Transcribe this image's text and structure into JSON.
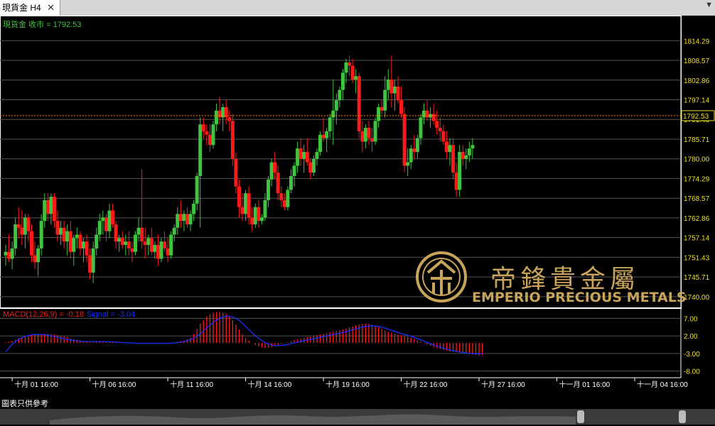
{
  "window": {
    "tab_title": "現貨金 H4",
    "close_glyph": "✕",
    "menu_glyph": "▼"
  },
  "disclaimer": "圖表只供參考",
  "logo": {
    "chinese": "帝鋒貴金屬",
    "english": "EMPERIO PRECIOUS METALS",
    "color": "#c8a45a"
  },
  "colors": {
    "bull": "#3fc43f",
    "bear": "#ff1a1a",
    "price_label": "#f0e020",
    "current_line": "#ff8c00",
    "macd_hist": "#ff1a1a",
    "macd_signal": "#1830ff"
  },
  "chart_data": [
    {
      "type": "candlestick",
      "title": "現貨金 收市 = 1792.53",
      "symbol": "現貨金",
      "timeframe": "H4",
      "current_price": 1792.53,
      "current_price_label": "1792.53",
      "ylim": [
        1737.5,
        1819.5
      ],
      "y_ticks": [
        1814.29,
        1808.57,
        1802.86,
        1797.14,
        1791.43,
        1785.71,
        1780.0,
        1774.29,
        1768.57,
        1762.86,
        1757.14,
        1751.43,
        1745.71,
        1740.0
      ],
      "y_tick_labels": [
        "1814.29",
        "1808.57",
        "1802.86",
        "1797.14",
        "1791.43",
        "1785.71",
        "1780.00",
        "1774.29",
        "1768.57",
        "1762.86",
        "1757.14",
        "1751.43",
        "1745.71",
        "1740.00"
      ],
      "x_tick_labels": [
        "十月 01 16:00",
        "十月 06 16:00",
        "十月 11 16:00",
        "十月 14 16:00",
        "十月 19 16:00",
        "十月 22 16:00",
        "十月 27 16:00",
        "十一月 01 16:00",
        "十一月 04 16:00"
      ],
      "x_tick_index": [
        2,
        26,
        50,
        74,
        98,
        122,
        146,
        170,
        194
      ],
      "grid": true,
      "ohlc": [
        [
          1752,
          1755,
          1749,
          1753
        ],
        [
          1753,
          1758,
          1750,
          1751
        ],
        [
          1751,
          1756,
          1748,
          1754
        ],
        [
          1754,
          1763,
          1752,
          1761
        ],
        [
          1761,
          1766,
          1757,
          1760
        ],
        [
          1760,
          1765,
          1755,
          1758
        ],
        [
          1758,
          1764,
          1754,
          1763
        ],
        [
          1763,
          1764,
          1756,
          1759
        ],
        [
          1759,
          1761,
          1750,
          1752
        ],
        [
          1752,
          1756,
          1748,
          1750
        ],
        [
          1750,
          1755,
          1746,
          1754
        ],
        [
          1754,
          1764,
          1752,
          1762
        ],
        [
          1762,
          1770,
          1760,
          1768
        ],
        [
          1768,
          1770,
          1762,
          1764
        ],
        [
          1764,
          1770,
          1761,
          1769
        ],
        [
          1769,
          1770,
          1760,
          1762
        ],
        [
          1762,
          1765,
          1756,
          1758
        ],
        [
          1758,
          1762,
          1755,
          1760
        ],
        [
          1760,
          1762,
          1754,
          1756
        ],
        [
          1756,
          1761,
          1752,
          1759
        ],
        [
          1759,
          1762,
          1751,
          1753
        ],
        [
          1753,
          1758,
          1749,
          1757
        ],
        [
          1757,
          1760,
          1754,
          1758
        ],
        [
          1758,
          1759,
          1752,
          1754
        ],
        [
          1754,
          1757,
          1750,
          1756
        ],
        [
          1756,
          1758,
          1750,
          1752
        ],
        [
          1752,
          1754,
          1745,
          1747
        ],
        [
          1747,
          1756,
          1744,
          1754
        ],
        [
          1754,
          1760,
          1752,
          1758
        ],
        [
          1758,
          1764,
          1756,
          1762
        ],
        [
          1762,
          1765,
          1758,
          1763
        ],
        [
          1763,
          1764,
          1756,
          1759
        ],
        [
          1759,
          1767,
          1757,
          1765
        ],
        [
          1765,
          1767,
          1760,
          1761
        ],
        [
          1761,
          1762,
          1754,
          1756
        ],
        [
          1756,
          1758,
          1753,
          1757
        ],
        [
          1757,
          1759,
          1754,
          1755
        ],
        [
          1755,
          1758,
          1752,
          1756
        ],
        [
          1756,
          1759,
          1752,
          1754
        ],
        [
          1754,
          1756,
          1750,
          1753
        ],
        [
          1753,
          1759,
          1752,
          1758
        ],
        [
          1758,
          1763,
          1756,
          1760
        ],
        [
          1760,
          1777,
          1754,
          1756
        ],
        [
          1756,
          1760,
          1751,
          1755
        ],
        [
          1755,
          1758,
          1752,
          1757
        ],
        [
          1757,
          1760,
          1752,
          1753
        ],
        [
          1753,
          1756,
          1751,
          1755
        ],
        [
          1755,
          1758,
          1749,
          1751
        ],
        [
          1751,
          1757,
          1750,
          1756
        ],
        [
          1756,
          1759,
          1753,
          1754
        ],
        [
          1754,
          1757,
          1750,
          1752
        ],
        [
          1752,
          1759,
          1751,
          1758
        ],
        [
          1758,
          1761,
          1756,
          1760
        ],
        [
          1760,
          1766,
          1758,
          1764
        ],
        [
          1764,
          1768,
          1760,
          1762
        ],
        [
          1762,
          1765,
          1759,
          1764
        ],
        [
          1764,
          1766,
          1760,
          1761
        ],
        [
          1761,
          1765,
          1759,
          1764
        ],
        [
          1764,
          1768,
          1762,
          1767
        ],
        [
          1767,
          1776,
          1765,
          1775
        ],
        [
          1775,
          1792,
          1760,
          1790
        ],
        [
          1790,
          1792,
          1786,
          1788
        ],
        [
          1788,
          1790,
          1784,
          1787
        ],
        [
          1787,
          1790,
          1782,
          1784
        ],
        [
          1784,
          1791,
          1783,
          1790
        ],
        [
          1790,
          1796,
          1788,
          1794
        ],
        [
          1794,
          1798,
          1790,
          1792
        ],
        [
          1792,
          1796,
          1788,
          1795
        ],
        [
          1795,
          1797,
          1790,
          1792
        ],
        [
          1792,
          1794,
          1788,
          1791
        ],
        [
          1791,
          1793,
          1778,
          1780
        ],
        [
          1780,
          1782,
          1770,
          1772
        ],
        [
          1772,
          1774,
          1763,
          1766
        ],
        [
          1766,
          1770,
          1762,
          1764
        ],
        [
          1764,
          1771,
          1762,
          1770
        ],
        [
          1770,
          1772,
          1761,
          1763
        ],
        [
          1763,
          1766,
          1759,
          1761
        ],
        [
          1761,
          1767,
          1760,
          1766
        ],
        [
          1766,
          1768,
          1760,
          1762
        ],
        [
          1762,
          1764,
          1761,
          1763
        ],
        [
          1763,
          1770,
          1762,
          1768
        ],
        [
          1768,
          1775,
          1766,
          1774
        ],
        [
          1774,
          1780,
          1772,
          1779
        ],
        [
          1779,
          1782,
          1774,
          1776
        ],
        [
          1776,
          1778,
          1768,
          1770
        ],
        [
          1770,
          1772,
          1766,
          1768
        ],
        [
          1768,
          1770,
          1765,
          1766
        ],
        [
          1766,
          1772,
          1765,
          1771
        ],
        [
          1771,
          1777,
          1770,
          1775
        ],
        [
          1775,
          1779,
          1772,
          1778
        ],
        [
          1778,
          1785,
          1776,
          1783
        ],
        [
          1783,
          1786,
          1778,
          1780
        ],
        [
          1780,
          1784,
          1776,
          1782
        ],
        [
          1782,
          1786,
          1778,
          1779
        ],
        [
          1779,
          1780,
          1774,
          1776
        ],
        [
          1776,
          1781,
          1775,
          1780
        ],
        [
          1780,
          1783,
          1778,
          1782
        ],
        [
          1782,
          1788,
          1781,
          1787
        ],
        [
          1787,
          1792,
          1785,
          1786
        ],
        [
          1786,
          1789,
          1782,
          1788
        ],
        [
          1788,
          1793,
          1786,
          1792
        ],
        [
          1792,
          1803,
          1784,
          1794
        ],
        [
          1794,
          1799,
          1790,
          1797
        ],
        [
          1797,
          1801,
          1795,
          1800
        ],
        [
          1800,
          1806,
          1797,
          1805
        ],
        [
          1805,
          1809,
          1802,
          1808
        ],
        [
          1808,
          1810,
          1804,
          1807
        ],
        [
          1807,
          1809,
          1802,
          1803
        ],
        [
          1803,
          1806,
          1799,
          1804
        ],
        [
          1804,
          1805,
          1786,
          1788
        ],
        [
          1788,
          1791,
          1782,
          1785
        ],
        [
          1785,
          1790,
          1783,
          1789
        ],
        [
          1789,
          1791,
          1784,
          1786
        ],
        [
          1786,
          1789,
          1782,
          1785
        ],
        [
          1785,
          1792,
          1784,
          1791
        ],
        [
          1791,
          1796,
          1789,
          1795
        ],
        [
          1795,
          1797,
          1793,
          1794
        ],
        [
          1794,
          1804,
          1792,
          1800
        ],
        [
          1800,
          1806,
          1797,
          1803
        ],
        [
          1803,
          1810,
          1795,
          1799
        ],
        [
          1799,
          1803,
          1794,
          1801
        ],
        [
          1801,
          1804,
          1796,
          1797
        ],
        [
          1797,
          1801,
          1792,
          1793
        ],
        [
          1793,
          1795,
          1776,
          1778
        ],
        [
          1778,
          1783,
          1775,
          1779
        ],
        [
          1779,
          1784,
          1777,
          1783
        ],
        [
          1783,
          1787,
          1780,
          1782
        ],
        [
          1782,
          1787,
          1780,
          1786
        ],
        [
          1786,
          1793,
          1784,
          1792
        ],
        [
          1792,
          1796,
          1790,
          1794
        ],
        [
          1794,
          1797,
          1791,
          1792
        ],
        [
          1792,
          1795,
          1789,
          1793
        ],
        [
          1793,
          1796,
          1790,
          1791
        ],
        [
          1791,
          1794,
          1787,
          1789
        ],
        [
          1789,
          1792,
          1785,
          1788
        ],
        [
          1788,
          1790,
          1784,
          1785
        ],
        [
          1785,
          1788,
          1780,
          1782
        ],
        [
          1782,
          1786,
          1778,
          1784
        ],
        [
          1784,
          1786,
          1774,
          1776
        ],
        [
          1776,
          1779,
          1769,
          1771
        ],
        [
          1771,
          1784,
          1769,
          1782
        ],
        [
          1782,
          1784,
          1778,
          1780
        ],
        [
          1780,
          1783,
          1777,
          1781
        ],
        [
          1781,
          1785,
          1779,
          1783
        ],
        [
          1783,
          1786,
          1780,
          1784
        ]
      ],
      "x_total": 210
    },
    {
      "type": "bar",
      "title": "MACD(12,26,9) = -0.18",
      "signal_title": "Signal = -3.04",
      "ylim": [
        -9.5,
        9.5
      ],
      "y_ticks": [
        7.0,
        2.0,
        -3.0,
        -8.0
      ],
      "y_tick_labels": [
        "7.00",
        "2.00",
        "-3.00",
        "-8.00"
      ],
      "macd": [
        0.2,
        0.4,
        0.6,
        0.9,
        1.3,
        1.6,
        1.9,
        2.1,
        2.2,
        2.3,
        2.4,
        2.5,
        2.6,
        2.6,
        2.5,
        2.4,
        2.2,
        2.0,
        1.8,
        1.6,
        1.3,
        1.1,
        0.9,
        0.7,
        0.5,
        0.4,
        0.3,
        0.2,
        0.3,
        0.4,
        0.5,
        0.5,
        0.4,
        0.3,
        0.2,
        0.2,
        0.1,
        0.0,
        -0.1,
        -0.1,
        -0.2,
        -0.2,
        -0.1,
        0.0,
        0.0,
        -0.1,
        -0.1,
        -0.2,
        -0.2,
        -0.1,
        -0.1,
        0.0,
        0.1,
        0.3,
        0.5,
        0.7,
        1.0,
        1.5,
        2.5,
        4.0,
        5.5,
        6.5,
        7.5,
        8.2,
        8.6,
        8.8,
        8.8,
        8.6,
        8.2,
        7.5,
        6.5,
        5.2,
        3.8,
        2.5,
        1.5,
        0.6,
        0.0,
        -0.6,
        -1.0,
        -1.3,
        -1.5,
        -1.4,
        -1.2,
        -0.9,
        -0.6,
        -0.3,
        0.0,
        0.2,
        0.5,
        0.8,
        1.0,
        1.2,
        1.4,
        1.6,
        1.8,
        2.0,
        2.2,
        2.4,
        2.6,
        2.8,
        3.0,
        3.2,
        3.4,
        3.6,
        3.8,
        4.1,
        4.4,
        4.7,
        5.0,
        5.2,
        5.4,
        5.5,
        5.4,
        5.2,
        4.9,
        4.5,
        4.0,
        3.6,
        3.2,
        2.9,
        2.6,
        2.4,
        2.2,
        2.0,
        1.8,
        1.5,
        1.2,
        0.8,
        0.4,
        0.0,
        -0.4,
        -0.8,
        -1.2,
        -1.5,
        -1.8,
        -2.0,
        -2.2,
        -2.4,
        -2.5,
        -2.6,
        -2.7,
        -2.8,
        -3.0,
        -3.2,
        -3.3,
        -3.4,
        -3.5,
        -3.5
      ],
      "signal": [
        -2.5,
        -1.4,
        -0.4,
        0.4,
        1.0,
        1.5,
        1.9,
        2.1,
        2.3,
        2.4,
        2.4,
        2.4,
        2.3,
        2.2,
        2.0,
        1.8,
        1.6,
        1.4,
        1.2,
        1.0,
        0.8,
        0.7,
        0.6,
        0.5,
        0.4,
        0.4,
        0.4,
        0.4,
        0.4,
        0.4,
        0.4,
        0.4,
        0.3,
        0.3,
        0.2,
        0.2,
        0.1,
        0.1,
        0.0,
        0.0,
        -0.1,
        -0.1,
        -0.1,
        -0.1,
        -0.1,
        -0.1,
        -0.1,
        -0.1,
        -0.1,
        -0.1,
        -0.1,
        -0.1,
        0.0,
        0.1,
        0.2,
        0.4,
        0.6,
        0.9,
        1.3,
        1.9,
        2.6,
        3.4,
        4.3,
        5.1,
        5.8,
        6.5,
        7.0,
        7.4,
        7.6,
        7.6,
        7.4,
        7.0,
        6.4,
        5.6,
        4.7,
        3.8,
        2.9,
        2.1,
        1.3,
        0.7,
        0.1,
        -0.3,
        -0.6,
        -0.8,
        -0.8,
        -0.7,
        -0.6,
        -0.4,
        -0.2,
        0.0,
        0.2,
        0.4,
        0.6,
        0.8,
        1.0,
        1.2,
        1.4,
        1.6,
        1.8,
        2.0,
        2.2,
        2.4,
        2.6,
        2.8,
        3.0,
        3.2,
        3.5,
        3.8,
        4.0,
        4.3,
        4.5,
        4.7,
        4.8,
        4.9,
        4.8,
        4.7,
        4.5,
        4.2,
        3.9,
        3.6,
        3.3,
        3.0,
        2.7,
        2.4,
        2.2,
        1.9,
        1.6,
        1.2,
        0.9,
        0.5,
        0.1,
        -0.2,
        -0.6,
        -0.9,
        -1.2,
        -1.5,
        -1.8,
        -2.0,
        -2.2,
        -2.4,
        -2.6,
        -2.7,
        -2.9,
        -3.0,
        -3.1,
        -3.1,
        -3.1,
        -3.0
      ]
    }
  ]
}
